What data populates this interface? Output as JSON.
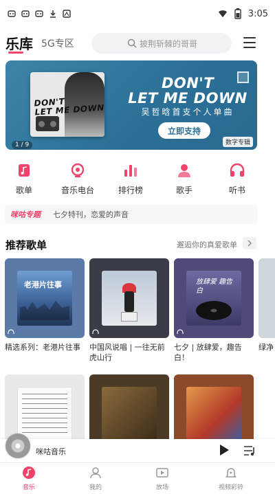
{
  "status_bar": {
    "time": "3:05",
    "left_icons": [
      "notification-icon",
      "notification-icon",
      "notification-icon",
      "download-icon",
      "app-icon"
    ],
    "right_icons": [
      "wifi-icon",
      "battery-icon"
    ]
  },
  "header": {
    "tab_main": "乐库",
    "tab_5g": "5G专区",
    "search_placeholder": "披荆斩棘的哥哥"
  },
  "banner": {
    "headline_line1": "DON'T",
    "headline_line2": "LET ME DOWN",
    "subtitle": "吴哲晗首支个人单曲",
    "cover_title_line1": "DON'T",
    "cover_title_line2": "LET ME DOWN",
    "button": "立即支持",
    "page_indicator": "1 / 9",
    "tag": "数字专辑"
  },
  "quick_nav": [
    {
      "label": "歌单",
      "icon": "playlist-icon"
    },
    {
      "label": "音乐电台",
      "icon": "radio-icon"
    },
    {
      "label": "排行榜",
      "icon": "chart-icon"
    },
    {
      "label": "歌手",
      "icon": "singer-icon"
    },
    {
      "label": "听书",
      "icon": "headphones-icon"
    }
  ],
  "notice": {
    "tag": "咪咕专题",
    "text": "七夕特刊，恋爱的声音"
  },
  "section": {
    "title": "推荐歌单",
    "more": "邂逅你的真爱歌单"
  },
  "playlists": [
    {
      "title": "精选系列：老港片往事",
      "cover_text": "老港片往事",
      "bg": "#5b7aa8"
    },
    {
      "title": "中国风说唱 | 一往无前虎山行",
      "cover_text": "",
      "bg": "#3a3d48"
    },
    {
      "title": "七夕 | 放肆爱，趣告白！",
      "cover_text": "放肆爱 趣告白",
      "bg": "#4f4a78"
    },
    {
      "title": "绿净",
      "cover_text": "",
      "bg": "#cfd6dc"
    }
  ],
  "playlists_row2": [
    {
      "bg": "#e9e9e9"
    },
    {
      "bg": "#4b3a25"
    },
    {
      "bg": "#8c4a2a"
    }
  ],
  "player": {
    "title": "咪咕音乐"
  },
  "bottom_nav": [
    {
      "label": "音乐",
      "icon": "music-icon",
      "active": true
    },
    {
      "label": "我的",
      "icon": "profile-icon",
      "active": false
    },
    {
      "label": "放场",
      "icon": "video-icon",
      "active": false
    },
    {
      "label": "视频彩铃",
      "icon": "ringtone-icon",
      "active": false
    }
  ],
  "colors": {
    "accent": "#f0436c",
    "banner": "#2f7198"
  }
}
